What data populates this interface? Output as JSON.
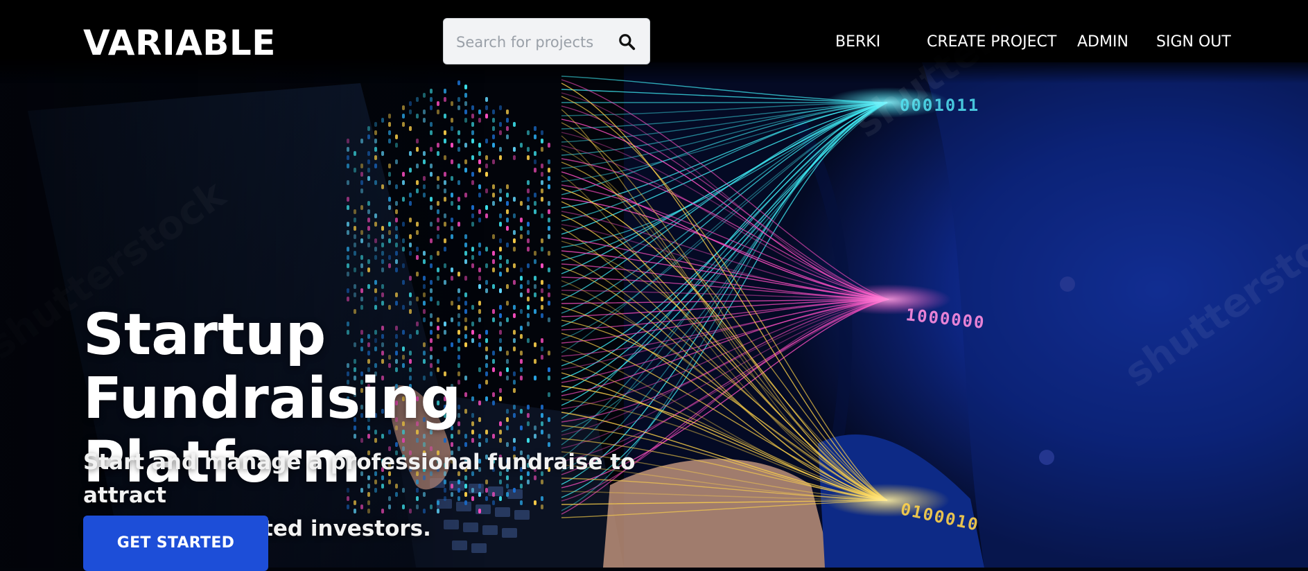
{
  "navbar": {
    "brand": "VARIABLE",
    "search": {
      "placeholder": "Search for projects",
      "value": "",
      "icon": "search-icon"
    },
    "links": [
      {
        "label": "BERKI"
      },
      {
        "label": "CREATE PROJECT"
      },
      {
        "label": "ADMIN"
      },
      {
        "label": "SIGN OUT"
      }
    ]
  },
  "hero": {
    "title_line1": "Startup Fundraising",
    "title_line2": "Platform",
    "subtitle_line1": "Start and manage a professional fundraise to attract",
    "subtitle_line2": "quality accredited investors.",
    "cta_label": "GET STARTED",
    "data_strings": [
      "0001011",
      "1000000",
      "0100010"
    ],
    "watermark": "shutterstock"
  },
  "colors": {
    "background": "#02040a",
    "cta": "#1d4ed8",
    "stream_cyan": "#3ee6f0",
    "stream_magenta": "#ff4fc3",
    "stream_yellow": "#ffd34a",
    "shirt_blue": "#0c2a8a"
  }
}
